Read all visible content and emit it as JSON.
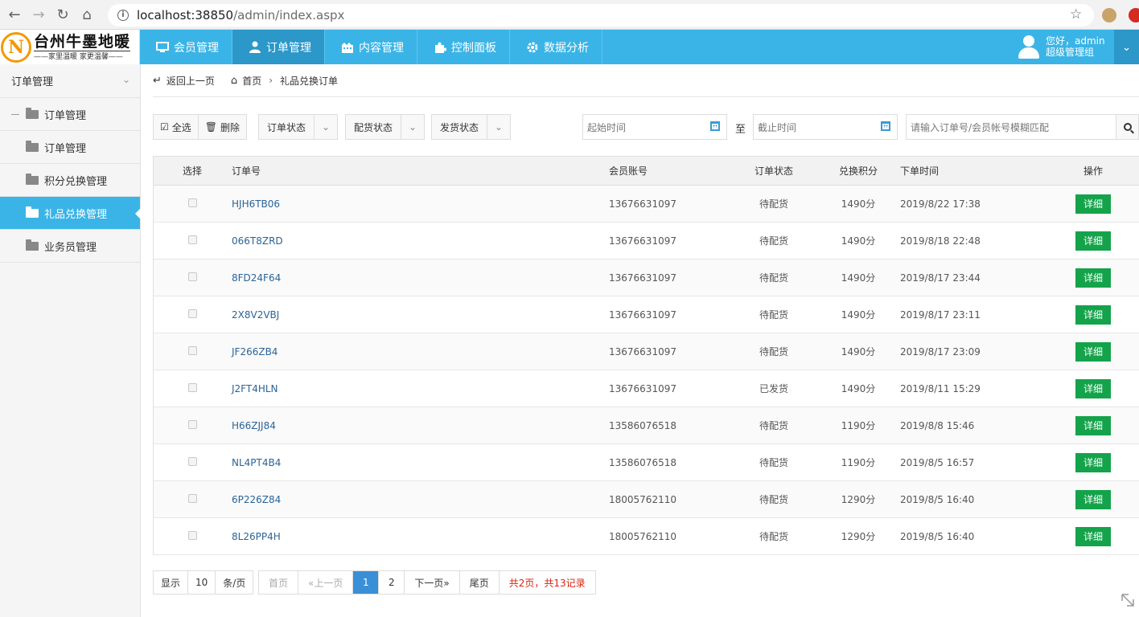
{
  "browser": {
    "url_host": "localhost:38850",
    "url_path": "/admin/index.aspx"
  },
  "brand": {
    "logo_letter": "N",
    "name": "台州牛墨地暖",
    "slogan": "——家里温暖 家更温馨——"
  },
  "topnav": [
    {
      "label": "会员管理",
      "icon": "monitor-icon"
    },
    {
      "label": "订单管理",
      "icon": "user-icon",
      "active": true
    },
    {
      "label": "内容管理",
      "icon": "building-icon"
    },
    {
      "label": "控制面板",
      "icon": "puzzle-icon"
    },
    {
      "label": "数据分析",
      "icon": "gear-icon"
    }
  ],
  "user": {
    "greeting": "您好，admin",
    "role": "超级管理组"
  },
  "sidebar": {
    "header": "订单管理",
    "parent": "订单管理",
    "items": [
      {
        "label": "订单管理"
      },
      {
        "label": "积分兑换管理"
      },
      {
        "label": "礼品兑换管理",
        "active": true
      },
      {
        "label": "业务员管理"
      }
    ]
  },
  "breadcrumb": {
    "back": "返回上一页",
    "home": "首页",
    "current": "礼品兑换订单"
  },
  "toolbar": {
    "select_all": "全选",
    "delete": "删除",
    "order_status": "订单状态",
    "dispatch_status": "配货状态",
    "ship_status": "发货状态",
    "start_placeholder": "起始时间",
    "to_label": "至",
    "end_placeholder": "截止时间",
    "search_placeholder": "请输入订单号/会员帐号模糊匹配"
  },
  "table": {
    "headers": {
      "select": "选择",
      "order_no": "订单号",
      "member": "会员账号",
      "status": "订单状态",
      "points": "兑换积分",
      "time": "下单时间",
      "action": "操作"
    },
    "detail_label": "详细",
    "rows": [
      {
        "order_no": "HJH6TB06",
        "member": "13676631097",
        "status": "待配货",
        "points": "1490分",
        "time": "2019/8/22 17:38"
      },
      {
        "order_no": "066T8ZRD",
        "member": "13676631097",
        "status": "待配货",
        "points": "1490分",
        "time": "2019/8/18 22:48"
      },
      {
        "order_no": "8FD24F64",
        "member": "13676631097",
        "status": "待配货",
        "points": "1490分",
        "time": "2019/8/17 23:44"
      },
      {
        "order_no": "2X8V2VBJ",
        "member": "13676631097",
        "status": "待配货",
        "points": "1490分",
        "time": "2019/8/17 23:11"
      },
      {
        "order_no": "JF266ZB4",
        "member": "13676631097",
        "status": "待配货",
        "points": "1490分",
        "time": "2019/8/17 23:09"
      },
      {
        "order_no": "J2FT4HLN",
        "member": "13676631097",
        "status": "已发货",
        "points": "1490分",
        "time": "2019/8/11 15:29"
      },
      {
        "order_no": "H66ZJJ84",
        "member": "13586076518",
        "status": "待配货",
        "points": "1190分",
        "time": "2019/8/8 15:46"
      },
      {
        "order_no": "NL4PT4B4",
        "member": "13586076518",
        "status": "待配货",
        "points": "1190分",
        "time": "2019/8/5 16:57"
      },
      {
        "order_no": "6P226Z84",
        "member": "18005762110",
        "status": "待配货",
        "points": "1290分",
        "time": "2019/8/5 16:40"
      },
      {
        "order_no": "8L26PP4H",
        "member": "18005762110",
        "status": "待配货",
        "points": "1290分",
        "time": "2019/8/5 16:40"
      }
    ]
  },
  "pagination": {
    "show_label": "显示",
    "page_size": "10",
    "per_page_label": "条/页",
    "first": "首页",
    "prev": "«上一页",
    "pages": [
      "1",
      "2"
    ],
    "current_page": "1",
    "next": "下一页»",
    "last": "尾页",
    "summary": "共2页，共13记录"
  },
  "colors": {
    "topbar": "#3ab4e6",
    "active": "#2c97c9",
    "detail_button": "#14a34b",
    "page_current": "#3a8fd6",
    "summary_red": "#d9230f"
  }
}
